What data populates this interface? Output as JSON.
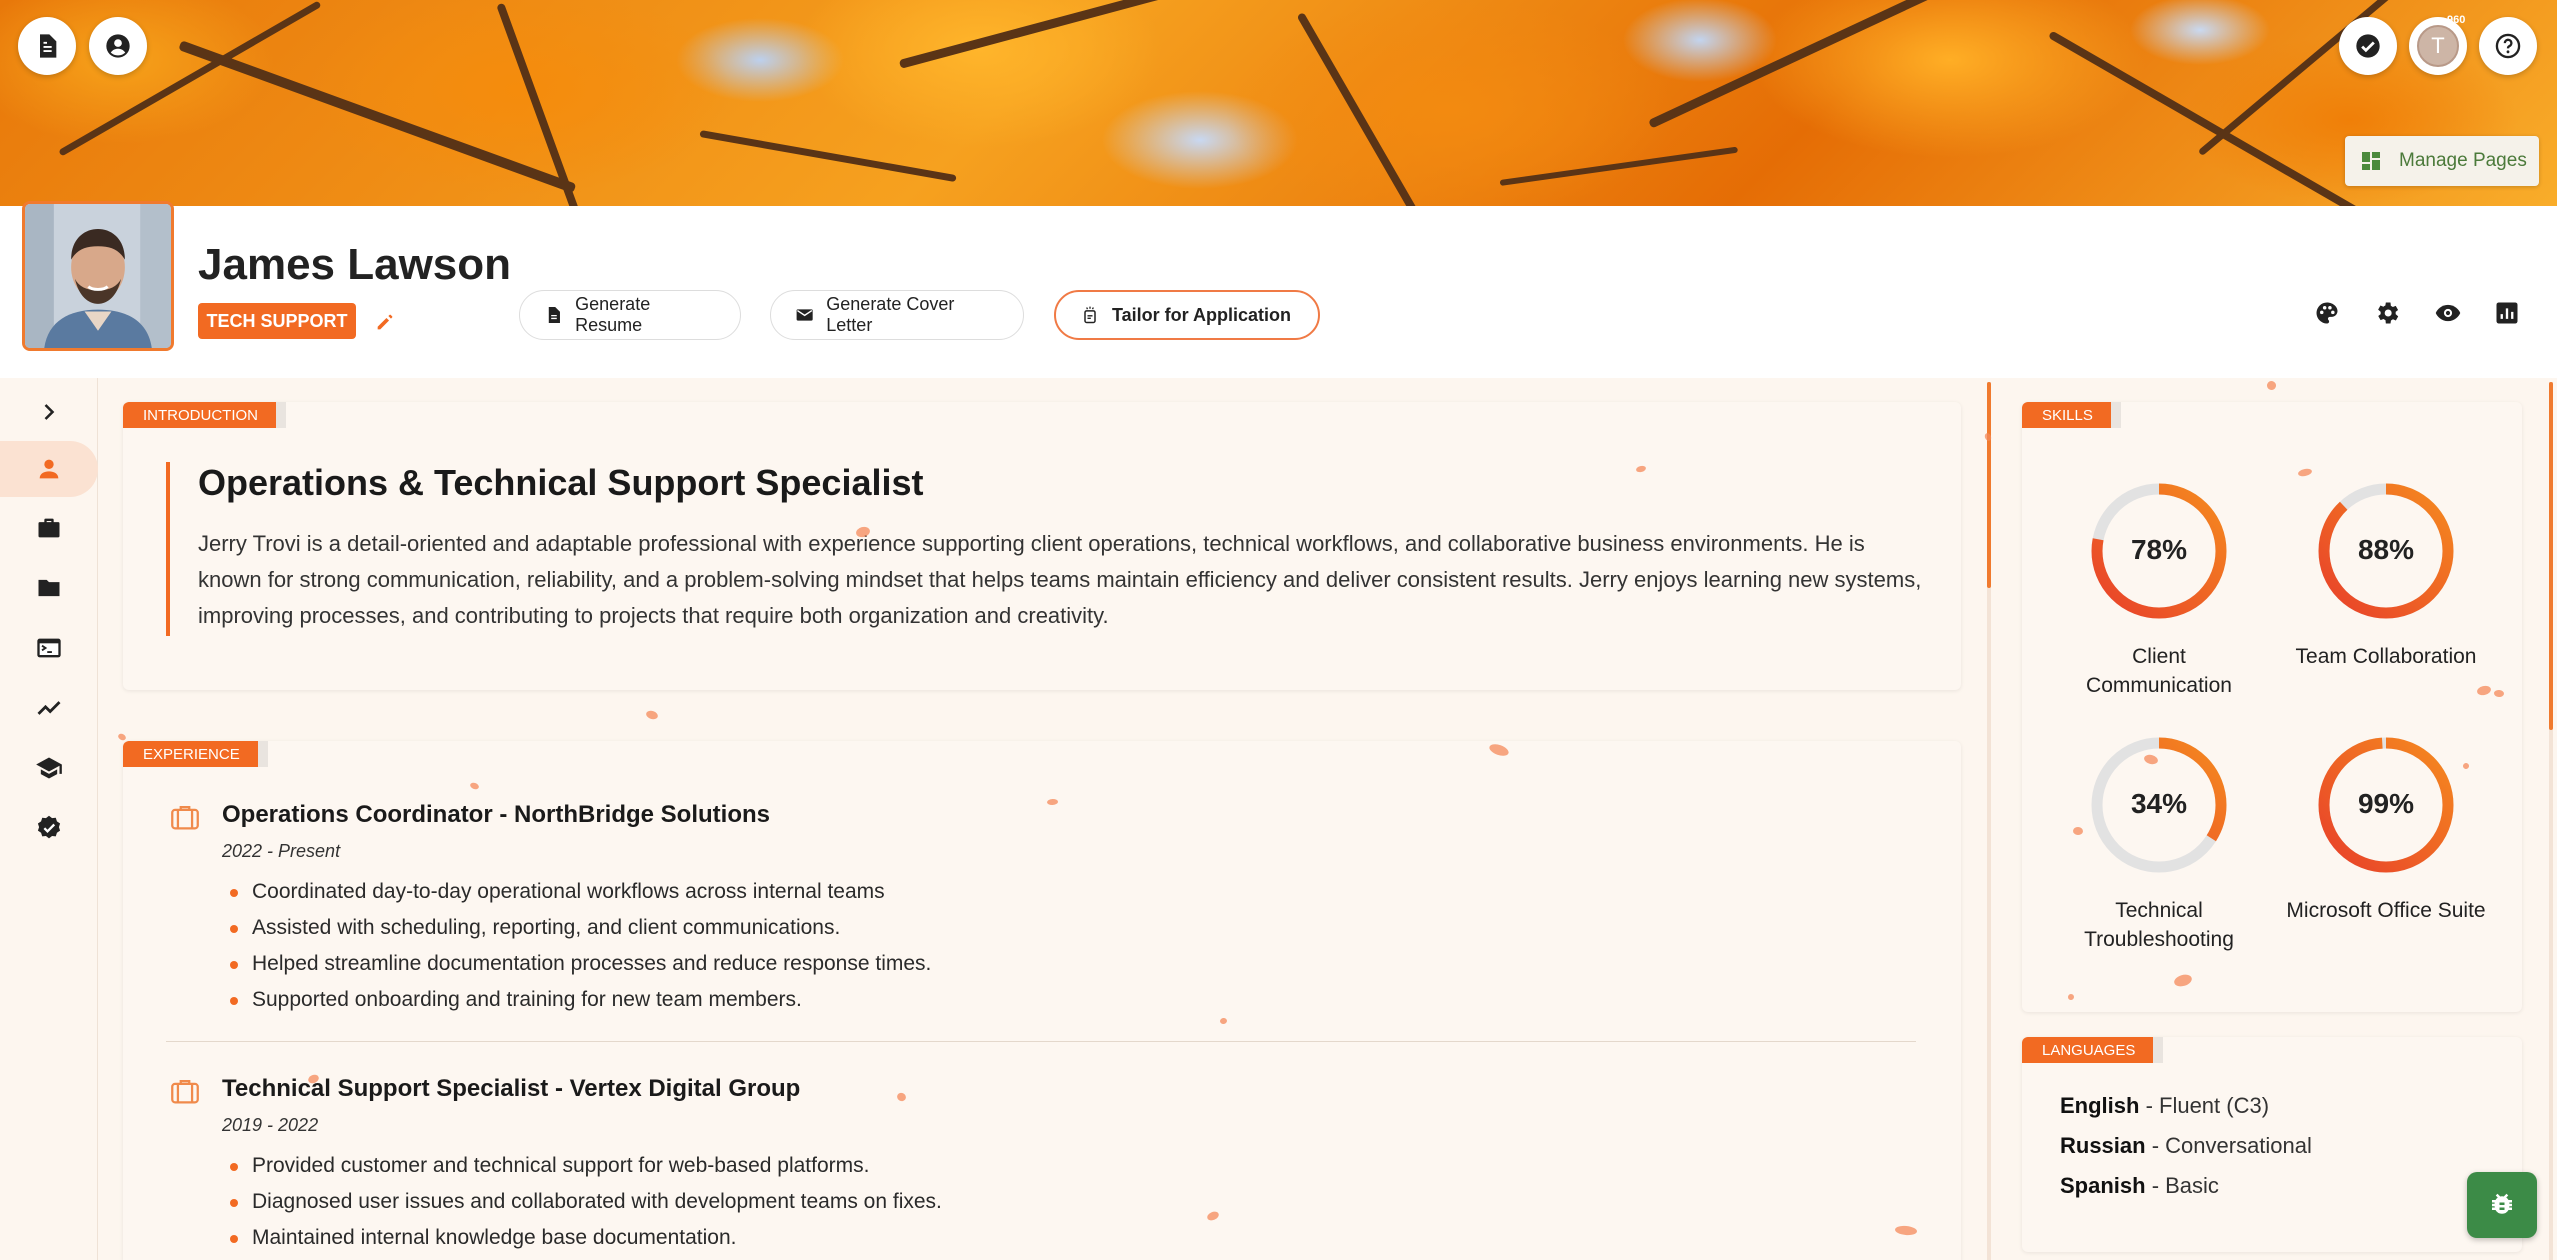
{
  "header": {
    "name": "James Lawson",
    "role_badge": "TECH SUPPORT",
    "notification_count": "960",
    "avatar_initial": "T",
    "manage_pages_label": "Manage Pages"
  },
  "actions": {
    "generate_resume": "Generate Resume",
    "generate_cover_letter": "Generate Cover Letter",
    "tailor_for_application": "Tailor for Application"
  },
  "introduction": {
    "tag": "INTRODUCTION",
    "title": "Operations & Technical Support Specialist",
    "text": "Jerry Trovi is a detail-oriented and adaptable professional with experience supporting client operations, technical workflows, and collaborative business environments. He is known for strong communication, reliability, and a problem-solving mindset that helps teams maintain efficiency and deliver consistent results. Jerry enjoys learning new systems, improving processes, and contributing to projects that require both organization and creativity."
  },
  "experience": {
    "tag": "EXPERIENCE",
    "jobs": [
      {
        "title": "Operations Coordinator - NorthBridge Solutions",
        "date": "2022 - Present",
        "bullets": [
          "Coordinated day-to-day operational workflows across internal teams",
          "Assisted with scheduling, reporting, and client communications.",
          "Helped streamline documentation processes and reduce response times.",
          "Supported onboarding and training for new team members."
        ]
      },
      {
        "title": "Technical Support Specialist - Vertex Digital Group",
        "date": "2019 - 2022",
        "bullets": [
          "Provided customer and technical support for web-based platforms.",
          "Diagnosed user issues and collaborated with development teams on fixes.",
          "Maintained internal knowledge base documentation."
        ]
      }
    ]
  },
  "skills": {
    "tag": "SKILLS",
    "items": [
      {
        "name": "Client Communication",
        "percent": 78,
        "label": "78%"
      },
      {
        "name": "Team Collaboration",
        "percent": 88,
        "label": "88%"
      },
      {
        "name": "Technical Troubleshooting",
        "percent": 34,
        "label": "34%"
      },
      {
        "name": "Microsoft Office Suite",
        "percent": 99,
        "label": "99%"
      }
    ]
  },
  "languages": {
    "tag": "LANGUAGES",
    "items": [
      {
        "language": "English",
        "level": " - Fluent (C3)"
      },
      {
        "language": "Russian",
        "level": " - Conversational"
      },
      {
        "language": "Spanish",
        "level": " - Basic"
      }
    ]
  },
  "colors": {
    "accent": "#f26a22",
    "donut_track": "#e2e2e2"
  }
}
